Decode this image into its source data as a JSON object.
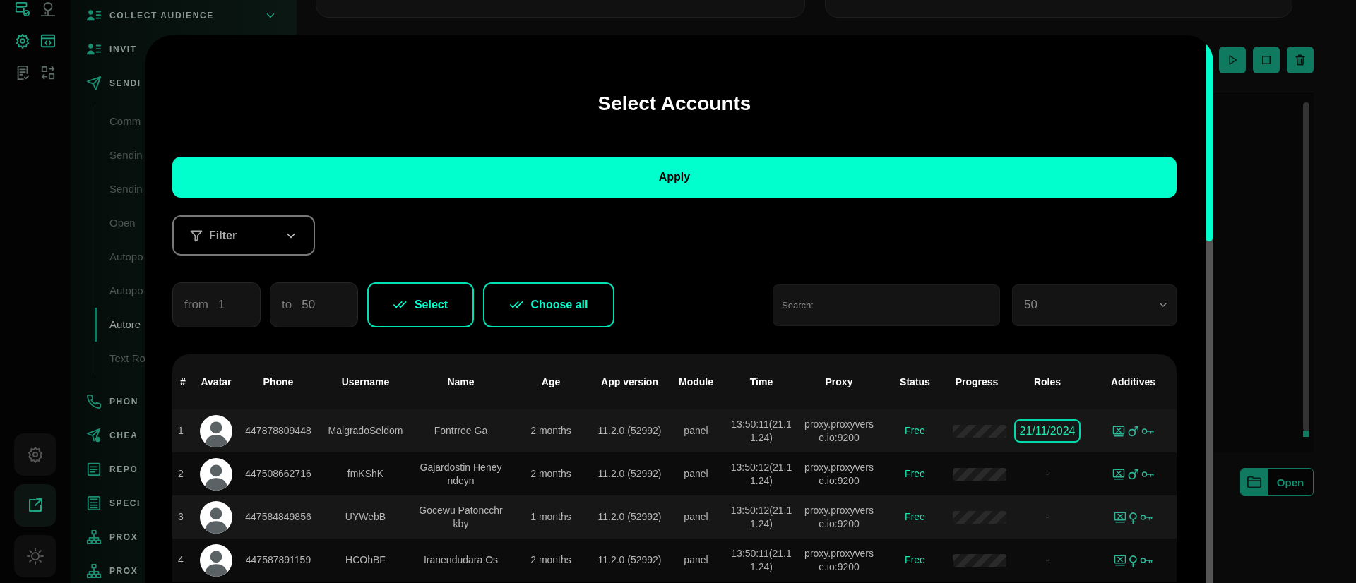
{
  "nav": {
    "items": [
      {
        "label": "COLLECT AUDIENCE",
        "expanded": false
      },
      {
        "label": "INVIT"
      },
      {
        "label": "SENDI",
        "expanded": true,
        "children": [
          {
            "label": "Comm",
            "selected": false
          },
          {
            "label": "Sendin",
            "selected": false
          },
          {
            "label": "Sendin",
            "selected": false
          },
          {
            "label": "Open",
            "selected": false
          },
          {
            "label": "Autopo",
            "selected": false
          },
          {
            "label": "Autopo",
            "selected": false
          },
          {
            "label": "Autore",
            "selected": true
          },
          {
            "label": "Text Ro",
            "selected": false
          }
        ]
      },
      {
        "label": "PHON"
      },
      {
        "label": "CHEA"
      },
      {
        "label": "REPO"
      },
      {
        "label": "SPECI"
      },
      {
        "label": "PROX"
      },
      {
        "label": "PROX"
      }
    ]
  },
  "side_panel": {
    "open_button": "Open"
  },
  "modal": {
    "title": "Select Accounts",
    "apply_button": "Apply",
    "filter": {
      "label": "Filter"
    },
    "range": {
      "from_label": "from",
      "from_value": "1",
      "to_label": "to",
      "to_value": "50"
    },
    "select_button": "Select",
    "choose_all_button": "Choose all",
    "search": {
      "placeholder": "Search:"
    },
    "page_size": {
      "value": "50"
    },
    "table": {
      "columns": [
        "#",
        "Avatar",
        "Phone",
        "Username",
        "Name",
        "Age",
        "App version",
        "Module",
        "Time",
        "Proxy",
        "Status",
        "Progress",
        "Roles",
        "Additives"
      ],
      "rows": [
        {
          "index": "1",
          "phone": "447878809448",
          "username": "MalgradoSeldom",
          "name": "Fontrree Ga",
          "age": "2 months",
          "app_version": "11.2.0 (52992)",
          "module": "panel",
          "time": "13:50:11(21.11.24)",
          "proxy": "proxy.proxyverse.io:9200",
          "status": "Free",
          "roles": {
            "kind": "badge",
            "text": "21/11/2024"
          },
          "gender": "♂"
        },
        {
          "index": "2",
          "phone": "447508662716",
          "username": "fmKShK",
          "name": "Gajardostin Heneyndeyn",
          "age": "2 months",
          "app_version": "11.2.0 (52992)",
          "module": "panel",
          "time": "13:50:12(21.11.24)",
          "proxy": "proxy.proxyverse.io:9200",
          "status": "Free",
          "roles": {
            "kind": "plain",
            "text": "-"
          },
          "gender": "♂"
        },
        {
          "index": "3",
          "phone": "447584849856",
          "username": "UYWebB",
          "name": "Gocewu Patoncchrkby",
          "age": "1 months",
          "app_version": "11.2.0 (52992)",
          "module": "panel",
          "time": "13:50:12(21.11.24)",
          "proxy": "proxy.proxyverse.io:9200",
          "status": "Free",
          "roles": {
            "kind": "plain",
            "text": "-"
          },
          "gender": "♀"
        },
        {
          "index": "4",
          "phone": "447587891159",
          "username": "HCOhBF",
          "name": "Iranendudara Os",
          "age": "2 months",
          "app_version": "11.2.0 (52992)",
          "module": "panel",
          "time": "13:50:11(21.11.24)",
          "proxy": "proxy.proxyverse.io:9200",
          "status": "Free",
          "roles": {
            "kind": "plain",
            "text": "-"
          },
          "gender": "♀"
        }
      ]
    }
  }
}
